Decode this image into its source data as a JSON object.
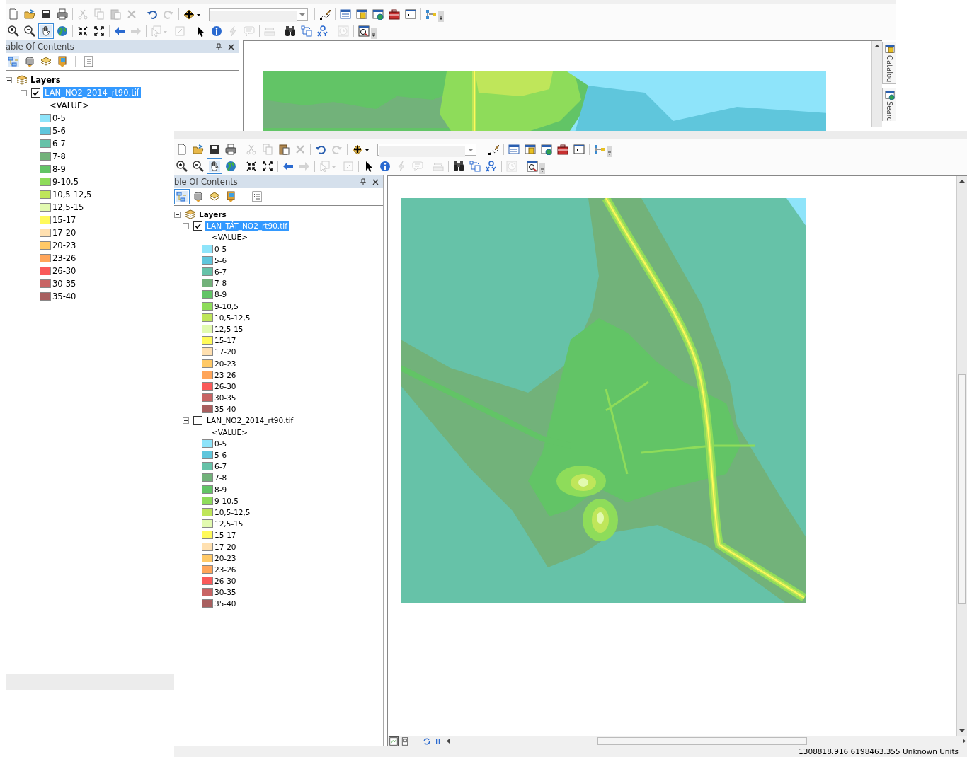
{
  "windows": [
    {
      "toolbars": [
        {
          "groups": [
            [
              {
                "kind": "new",
                "disabled": false,
                "selected": false
              },
              {
                "kind": "open",
                "disabled": false,
                "selected": false
              },
              {
                "kind": "save",
                "disabled": false,
                "selected": false
              },
              {
                "kind": "print",
                "disabled": false,
                "selected": false
              }
            ],
            [
              {
                "kind": "cut",
                "disabled": true,
                "selected": false
              },
              {
                "kind": "copy",
                "disabled": true,
                "selected": false
              },
              {
                "kind": "paste",
                "disabled": true,
                "selected": false
              },
              {
                "kind": "delete",
                "disabled": true,
                "selected": false
              }
            ],
            [
              {
                "kind": "undo",
                "disabled": false,
                "selected": false
              },
              {
                "kind": "redo",
                "disabled": true,
                "selected": false
              }
            ],
            [
              {
                "kind": "add",
                "disabled": false,
                "selected": false
              },
              {
                "kind": "combo"
              }
            ],
            [
              {
                "kind": "editor",
                "disabled": false,
                "selected": false
              }
            ],
            [
              {
                "kind": "toc",
                "disabled": false,
                "selected": false
              },
              {
                "kind": "catalog",
                "disabled": false,
                "selected": false
              },
              {
                "kind": "search",
                "disabled": false,
                "selected": false
              },
              {
                "kind": "toolbox",
                "disabled": false,
                "selected": false
              },
              {
                "kind": "python",
                "disabled": false,
                "selected": false
              }
            ],
            [
              {
                "kind": "model",
                "disabled": false,
                "selected": false
              }
            ]
          ]
        },
        {
          "groups": [
            [
              {
                "kind": "zoomin",
                "disabled": false,
                "selected": false
              },
              {
                "kind": "zoomout",
                "disabled": false,
                "selected": false
              },
              {
                "kind": "pan",
                "disabled": false,
                "selected": true
              },
              {
                "kind": "globe",
                "disabled": false,
                "selected": false
              }
            ],
            [
              {
                "kind": "shrink",
                "disabled": false,
                "selected": false
              },
              {
                "kind": "expand",
                "disabled": false,
                "selected": false
              }
            ],
            [
              {
                "kind": "back",
                "disabled": false,
                "selected": false
              },
              {
                "kind": "forward",
                "disabled": true,
                "selected": false
              }
            ],
            [
              {
                "kind": "selectfeat",
                "disabled": true,
                "selected": false
              },
              {
                "kind": "clear",
                "disabled": true,
                "selected": false
              }
            ],
            [
              {
                "kind": "pointer",
                "disabled": false,
                "selected": false
              },
              {
                "kind": "identify",
                "disabled": false,
                "selected": false
              },
              {
                "kind": "hyperlink",
                "disabled": true,
                "selected": false
              },
              {
                "kind": "popup",
                "disabled": true,
                "selected": false
              }
            ],
            [
              {
                "kind": "measure",
                "disabled": true,
                "selected": false
              }
            ],
            [
              {
                "kind": "find",
                "disabled": false,
                "selected": false
              },
              {
                "kind": "route",
                "disabled": false,
                "selected": false
              },
              {
                "kind": "xy",
                "disabled": false,
                "selected": false
              }
            ],
            [
              {
                "kind": "time",
                "disabled": true,
                "selected": false
              }
            ],
            [
              {
                "kind": "magnify",
                "disabled": false,
                "selected": false
              }
            ]
          ]
        }
      ],
      "toc": {
        "title": "able Of Contents",
        "tools": [
          [
            {
              "kind": "draworder",
              "selected": true
            },
            {
              "kind": "source",
              "selected": false
            },
            {
              "kind": "visibility",
              "selected": false
            },
            {
              "kind": "selection",
              "selected": false
            }
          ],
          [
            {
              "kind": "options",
              "selected": false
            }
          ]
        ],
        "root": {
          "label": "Layers",
          "expanded": true,
          "layers": [
            {
              "label": "LAN_NO2_2014_rt90.tif",
              "checked": true,
              "selected": true,
              "expanded": true,
              "field": "<VALUE>",
              "classes": [
                {
                  "label": "0-5",
                  "color": "#8ee4fa"
                },
                {
                  "label": "5-6",
                  "color": "#5fc6dc"
                },
                {
                  "label": "6-7",
                  "color": "#66c2a8"
                },
                {
                  "label": "7-8",
                  "color": "#72b27a"
                },
                {
                  "label": "8-9",
                  "color": "#62c466"
                },
                {
                  "label": "9-10,5",
                  "color": "#8edc5a"
                },
                {
                  "label": "10,5-12,5",
                  "color": "#bfe65a"
                },
                {
                  "label": "12,5-15",
                  "color": "#e2fab0"
                },
                {
                  "label": "15-17",
                  "color": "#fffa5a"
                },
                {
                  "label": "17-20",
                  "color": "#ffe0b0"
                },
                {
                  "label": "20-23",
                  "color": "#ffc966"
                },
                {
                  "label": "23-26",
                  "color": "#ffa55a"
                },
                {
                  "label": "26-30",
                  "color": "#fa5a5a"
                },
                {
                  "label": "30-35",
                  "color": "#c86464"
                },
                {
                  "label": "35-40",
                  "color": "#a85f5f"
                }
              ]
            }
          ]
        }
      },
      "side_tabs": [
        {
          "kind": "catalog",
          "label": "Catalog"
        },
        {
          "kind": "search",
          "label": "Searc"
        }
      ]
    },
    {
      "toolbars": [
        {
          "groups": [
            [
              {
                "kind": "new",
                "disabled": false,
                "selected": false
              },
              {
                "kind": "open",
                "disabled": false,
                "selected": false
              },
              {
                "kind": "save",
                "disabled": false,
                "selected": false
              },
              {
                "kind": "print",
                "disabled": false,
                "selected": false
              }
            ],
            [
              {
                "kind": "cut",
                "disabled": true,
                "selected": false
              },
              {
                "kind": "copy",
                "disabled": true,
                "selected": false
              },
              {
                "kind": "paste",
                "disabled": false,
                "selected": false
              },
              {
                "kind": "delete",
                "disabled": true,
                "selected": false
              }
            ],
            [
              {
                "kind": "undo",
                "disabled": false,
                "selected": false
              },
              {
                "kind": "redo",
                "disabled": true,
                "selected": false
              }
            ],
            [
              {
                "kind": "add",
                "disabled": false,
                "selected": false
              },
              {
                "kind": "combo"
              }
            ],
            [
              {
                "kind": "editor",
                "disabled": false,
                "selected": false
              }
            ],
            [
              {
                "kind": "toc",
                "disabled": false,
                "selected": false
              },
              {
                "kind": "catalog",
                "disabled": false,
                "selected": false
              },
              {
                "kind": "search",
                "disabled": false,
                "selected": false
              },
              {
                "kind": "toolbox",
                "disabled": false,
                "selected": false
              },
              {
                "kind": "python",
                "disabled": false,
                "selected": false
              }
            ],
            [
              {
                "kind": "model",
                "disabled": false,
                "selected": false
              }
            ]
          ]
        },
        {
          "groups": [
            [
              {
                "kind": "zoomin",
                "disabled": false,
                "selected": false
              },
              {
                "kind": "zoomout",
                "disabled": false,
                "selected": false
              },
              {
                "kind": "pan",
                "disabled": false,
                "selected": true
              },
              {
                "kind": "globe",
                "disabled": false,
                "selected": false
              }
            ],
            [
              {
                "kind": "shrink",
                "disabled": false,
                "selected": false
              },
              {
                "kind": "expand",
                "disabled": false,
                "selected": false
              }
            ],
            [
              {
                "kind": "back",
                "disabled": false,
                "selected": false
              },
              {
                "kind": "forward",
                "disabled": true,
                "selected": false
              }
            ],
            [
              {
                "kind": "selectfeat",
                "disabled": true,
                "selected": false
              },
              {
                "kind": "clear",
                "disabled": true,
                "selected": false
              }
            ],
            [
              {
                "kind": "pointer",
                "disabled": false,
                "selected": false
              },
              {
                "kind": "identify",
                "disabled": false,
                "selected": false
              },
              {
                "kind": "hyperlink",
                "disabled": true,
                "selected": false
              },
              {
                "kind": "popup",
                "disabled": true,
                "selected": false
              }
            ],
            [
              {
                "kind": "measure",
                "disabled": true,
                "selected": false
              }
            ],
            [
              {
                "kind": "find",
                "disabled": false,
                "selected": false
              },
              {
                "kind": "route",
                "disabled": false,
                "selected": false
              },
              {
                "kind": "xy",
                "disabled": false,
                "selected": false
              }
            ],
            [
              {
                "kind": "time",
                "disabled": true,
                "selected": false
              }
            ],
            [
              {
                "kind": "magnify",
                "disabled": false,
                "selected": false
              }
            ]
          ]
        }
      ],
      "toc": {
        "title": "ble Of Contents",
        "tools": [
          [
            {
              "kind": "draworder",
              "selected": true
            },
            {
              "kind": "source",
              "selected": false
            },
            {
              "kind": "visibility",
              "selected": false
            },
            {
              "kind": "selection",
              "selected": false
            }
          ],
          [
            {
              "kind": "options",
              "selected": false
            }
          ]
        ],
        "root": {
          "label": "Layers",
          "expanded": true,
          "layers": [
            {
              "label": "LAN_TÄT_NO2_rt90.tif",
              "checked": true,
              "selected": true,
              "expanded": true,
              "field": "<VALUE>",
              "classes": [
                {
                  "label": "0-5",
                  "color": "#8ee4fa"
                },
                {
                  "label": "5-6",
                  "color": "#5fc6dc"
                },
                {
                  "label": "6-7",
                  "color": "#66c2a8"
                },
                {
                  "label": "7-8",
                  "color": "#72b27a"
                },
                {
                  "label": "8-9",
                  "color": "#62c466"
                },
                {
                  "label": "9-10,5",
                  "color": "#8edc5a"
                },
                {
                  "label": "10,5-12,5",
                  "color": "#bfe65a"
                },
                {
                  "label": "12,5-15",
                  "color": "#e2fab0"
                },
                {
                  "label": "15-17",
                  "color": "#fffa5a"
                },
                {
                  "label": "17-20",
                  "color": "#ffe0b0"
                },
                {
                  "label": "20-23",
                  "color": "#ffc966"
                },
                {
                  "label": "23-26",
                  "color": "#ffa55a"
                },
                {
                  "label": "26-30",
                  "color": "#fa5a5a"
                },
                {
                  "label": "30-35",
                  "color": "#c86464"
                },
                {
                  "label": "35-40",
                  "color": "#a85f5f"
                }
              ]
            },
            {
              "label": "LAN_NO2_2014_rt90.tif",
              "checked": false,
              "selected": false,
              "expanded": true,
              "field": "<VALUE>",
              "classes": [
                {
                  "label": "0-5",
                  "color": "#8ee4fa"
                },
                {
                  "label": "5-6",
                  "color": "#5fc6dc"
                },
                {
                  "label": "6-7",
                  "color": "#66c2a8"
                },
                {
                  "label": "7-8",
                  "color": "#72b27a"
                },
                {
                  "label": "8-9",
                  "color": "#62c466"
                },
                {
                  "label": "9-10,5",
                  "color": "#8edc5a"
                },
                {
                  "label": "10,5-12,5",
                  "color": "#bfe65a"
                },
                {
                  "label": "12,5-15",
                  "color": "#e2fab0"
                },
                {
                  "label": "15-17",
                  "color": "#fffa5a"
                },
                {
                  "label": "17-20",
                  "color": "#ffe0b0"
                },
                {
                  "label": "20-23",
                  "color": "#ffc966"
                },
                {
                  "label": "23-26",
                  "color": "#ffa55a"
                },
                {
                  "label": "26-30",
                  "color": "#fa5a5a"
                },
                {
                  "label": "30-35",
                  "color": "#c86464"
                },
                {
                  "label": "35-40",
                  "color": "#a85f5f"
                }
              ]
            }
          ]
        }
      },
      "view_buttons": [
        {
          "kind": "data",
          "selected": true
        },
        {
          "kind": "layout",
          "selected": false
        }
      ],
      "status_bar": "1308818.916 6198463.355 Unknown Units"
    }
  ]
}
